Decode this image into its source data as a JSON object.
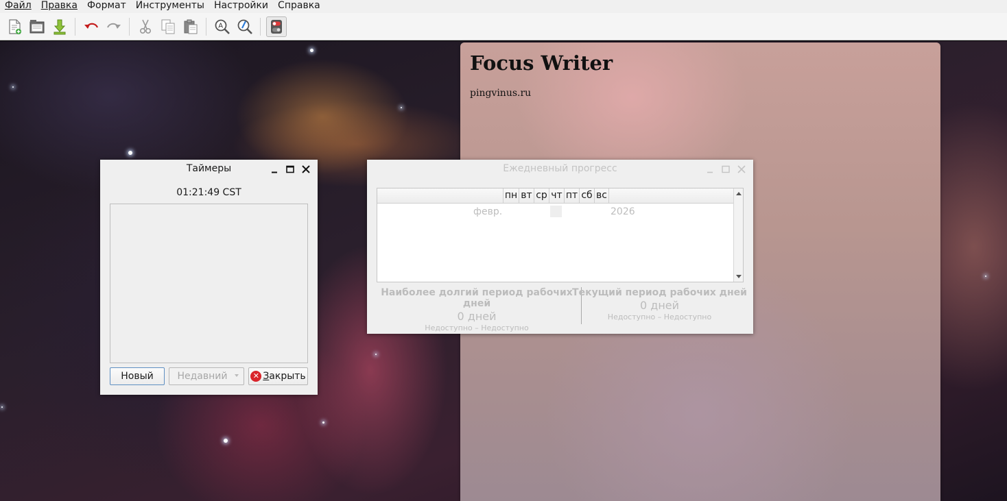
{
  "menubar": {
    "items": [
      {
        "label": "Файл"
      },
      {
        "label": "Правка"
      },
      {
        "label": "Формат"
      },
      {
        "label": "Инструменты"
      },
      {
        "label": "Настройки"
      },
      {
        "label": "Справка"
      }
    ]
  },
  "toolbar": {
    "icons": [
      "new-document-icon",
      "open-folder-icon",
      "save-icon",
      "undo-icon",
      "redo-icon",
      "cut-icon",
      "copy-icon",
      "paste-icon",
      "find-icon",
      "replace-icon",
      "toggle-focus-icon"
    ]
  },
  "document": {
    "title": "Focus Writer",
    "text": "pingvinus.ru"
  },
  "timers_dialog": {
    "title": "Таймеры",
    "clock": "01:21:49 CST",
    "new_label": "Новый",
    "recent_label": "Недавний",
    "close_label_prefix": "",
    "close_label_underlined": "З",
    "close_label_rest": "акрыть"
  },
  "progress_dialog": {
    "title": "Ежедневный прогресс",
    "weekdays": [
      "пн",
      "вт",
      "ср",
      "чт",
      "пт",
      "сб",
      "вс"
    ],
    "month": "февр.",
    "year": "2026",
    "longest": {
      "heading": "Наиболее долгий период рабочих дней",
      "value": "0 дней",
      "range": "Недоступно – Недоступно"
    },
    "current": {
      "heading": "Текущий период рабочих дней",
      "value": "0 дней",
      "range": "Недоступно – Недоступно"
    }
  },
  "colors": {
    "close_icon_red": "#d9252b",
    "focus_border": "#5e8fc2",
    "disabled_text": "#bcbcbc"
  }
}
